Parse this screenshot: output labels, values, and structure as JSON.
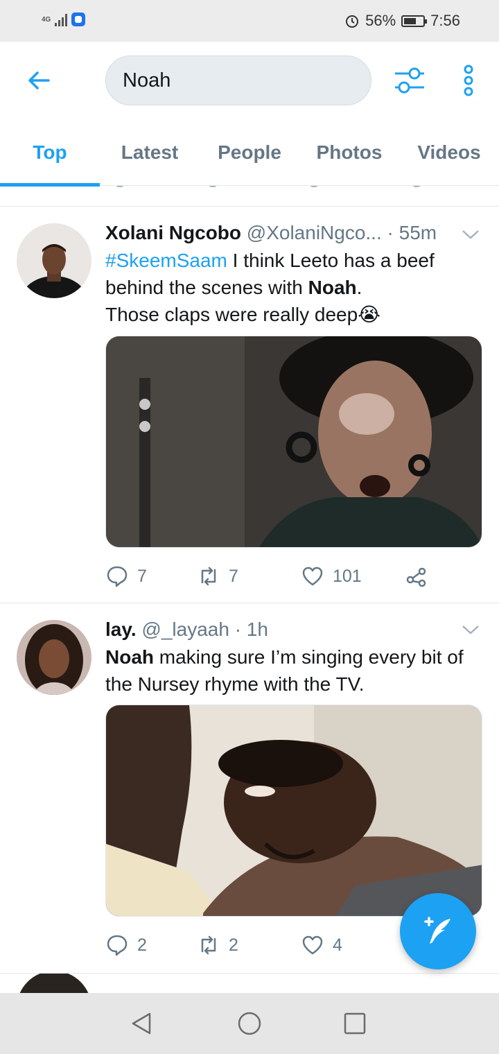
{
  "status_bar": {
    "network": "4G",
    "battery": "56%",
    "time": "7:56"
  },
  "search": {
    "query": "Noah"
  },
  "tabs": [
    {
      "label": "Top",
      "active": true
    },
    {
      "label": "Latest",
      "active": false
    },
    {
      "label": "People",
      "active": false
    },
    {
      "label": "Photos",
      "active": false
    },
    {
      "label": "Videos",
      "active": false
    }
  ],
  "tweets": [
    {
      "name": "Xolani Ngcobo",
      "handle": "@XolaniNgco...",
      "time": "· 55m",
      "hashtag": "#SkeemSaam",
      "text_1": " I think Leeto has a beef behind the scenes with ",
      "bold": "Noah",
      "text_2": ".",
      "text_3": "Those claps were really deep",
      "emoji": "😭",
      "replies": "7",
      "retweets": "7",
      "likes": "101"
    },
    {
      "name": "lay.",
      "handle": "@_layaah",
      "time": "· 1h",
      "bold": "Noah",
      "text_1": " making sure I’m singing every bit of the Nursey rhyme with the TV.",
      "replies": "2",
      "retweets": "2",
      "likes": "4"
    }
  ],
  "colors": {
    "accent": "#1da1f2",
    "secondary_text": "#657786",
    "primary_text": "#14171a"
  }
}
